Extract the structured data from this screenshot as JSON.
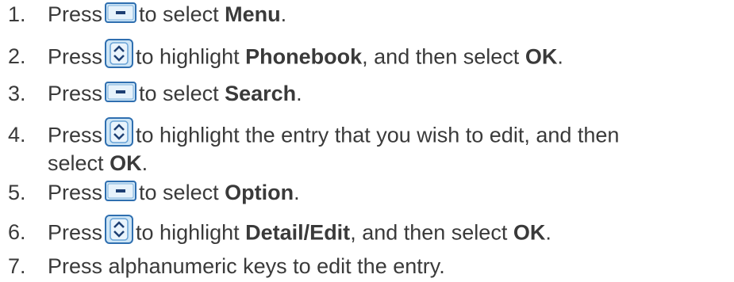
{
  "steps": [
    {
      "num": "1.",
      "a": "Press",
      "icon": "softkey-icon",
      "b": "to select",
      "bold": "Menu",
      "c": "."
    },
    {
      "num": "2.",
      "a": "Press",
      "icon": "navigation-key-icon",
      "b": "to highlight",
      "bold": "Phonebook",
      "c": ", and then select",
      "bold2": "OK",
      "d": "."
    },
    {
      "num": "3.",
      "a": "Press",
      "icon": "softkey-icon",
      "b": "to select",
      "bold": "Search",
      "c": "."
    },
    {
      "num": "4.",
      "a": "Press",
      "icon": "navigation-key-icon",
      "b": "to highlight the entry that you wish to edit, and then",
      "line2": "select",
      "bold": "OK",
      "c": "."
    },
    {
      "num": "5.",
      "a": "Press",
      "icon": "softkey-icon",
      "b": "to select",
      "bold": "Option",
      "c": "."
    },
    {
      "num": "6.",
      "a": "Press",
      "icon": "navigation-key-icon",
      "b": "to highlight",
      "bold": "Detail/Edit",
      "c": ", and then select",
      "bold2": "OK",
      "d": "."
    },
    {
      "num": "7.",
      "text": "Press alphanumeric keys to edit the entry."
    }
  ]
}
